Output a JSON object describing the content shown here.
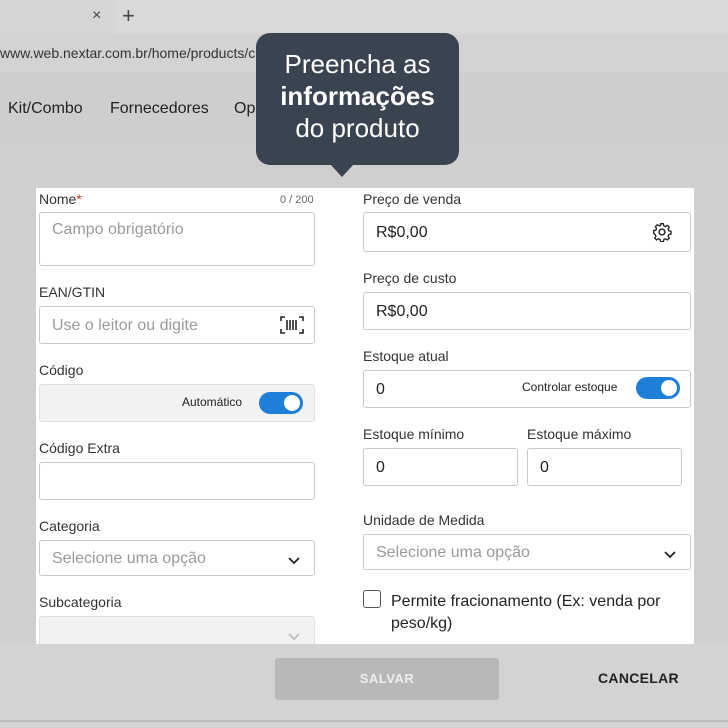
{
  "browser": {
    "tab_close": "×",
    "new_tab": "+",
    "url": "www.web.nextar.com.br/home/products/cr"
  },
  "nav": {
    "items": [
      "Kit/Combo",
      "Fornecedores",
      "Op"
    ]
  },
  "tooltip": {
    "line1": "Preencha as",
    "line2": "informações",
    "line3": "do produto"
  },
  "form": {
    "nome": {
      "label": "Nome",
      "required_mark": "*",
      "counter": "0 / 200",
      "placeholder": "Campo obrigatório"
    },
    "ean": {
      "label": "EAN/GTIN",
      "placeholder": "Use o leitor ou digite"
    },
    "codigo": {
      "label": "Código",
      "toggle_label": "Automático"
    },
    "codigo_extra": {
      "label": "Código Extra"
    },
    "categoria": {
      "label": "Categoria",
      "placeholder": "Selecione uma opção"
    },
    "subcategoria": {
      "label": "Subcategoria"
    },
    "preco_venda": {
      "label": "Preço de venda",
      "value": "R$0,00"
    },
    "preco_custo": {
      "label": "Preço de custo",
      "value": "R$0,00"
    },
    "estoque_atual": {
      "label": "Estoque atual",
      "value": "0",
      "toggle_label": "Controlar estoque"
    },
    "estoque_minimo": {
      "label": "Estoque mínimo",
      "value": "0"
    },
    "estoque_maximo": {
      "label": "Estoque máximo",
      "value": "0"
    },
    "unidade": {
      "label": "Unidade de Medida",
      "placeholder": "Selecione uma opção"
    },
    "fracionamento": {
      "line1": "Permite fracionamento (Ex: venda por",
      "line2": "peso/kg)"
    }
  },
  "actions": {
    "save": "SALVAR",
    "cancel": "CANCELAR"
  },
  "colors": {
    "accent": "#1e7fd8",
    "tooltip_bg": "#3a4450",
    "required": "#c0392b"
  }
}
